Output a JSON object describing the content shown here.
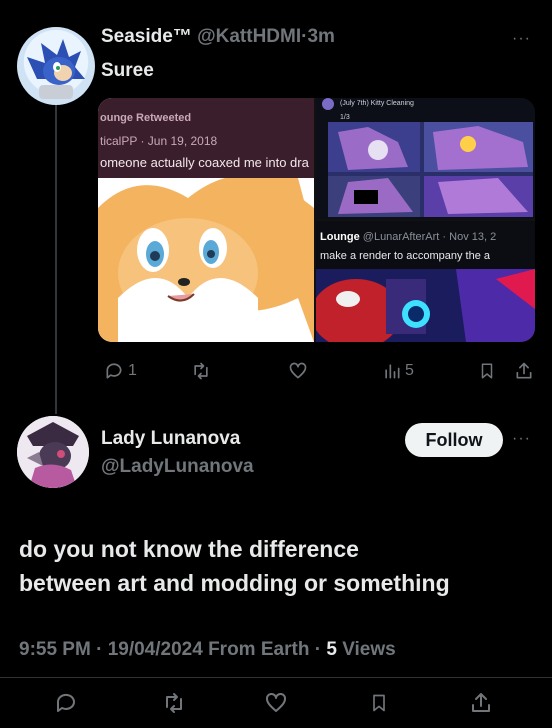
{
  "reply_context": {
    "display_name": "Seaside™",
    "handle": "@KattHDMI",
    "separator": "·",
    "time": "3m",
    "text": "Suree",
    "more": "···",
    "media": {
      "left": {
        "retweet_label": "ounge Retweeted",
        "source_line": "ticalPP · Jun 19, 2018",
        "snippet": "omeone actually coaxed me into dra"
      },
      "top_right": {
        "caption": "(July 7th) Kitty Cleaning",
        "page": "1/3"
      },
      "bottom_right": {
        "name": "Lounge",
        "handle_date": "@LunarAfterArt · Nov 13, 2",
        "snippet": "make a render to accompany the a"
      }
    },
    "actions": {
      "replies": "1",
      "retweets": "",
      "likes": "",
      "views": "5"
    }
  },
  "main_tweet": {
    "display_name": "Lady Lunanova",
    "handle": "@LadyLunanova",
    "follow_label": "Follow",
    "more": "···",
    "text_line1": "do you not know the difference",
    "text_line2": "between art and modding or something",
    "meta": {
      "time": "9:55 PM",
      "sep1": "·",
      "date": "19/04/2024",
      "source": "From Earth",
      "sep2": "·",
      "views_count": "5",
      "views_label": "Views"
    }
  },
  "icons": [
    "reply-icon",
    "retweet-icon",
    "like-icon",
    "views-icon",
    "bookmark-icon",
    "share-icon"
  ],
  "colors": {
    "background": "#000000",
    "text": "#e7e9ea",
    "muted": "#71767b",
    "divider": "#2f3336",
    "follow_bg": "#eff3f4"
  }
}
